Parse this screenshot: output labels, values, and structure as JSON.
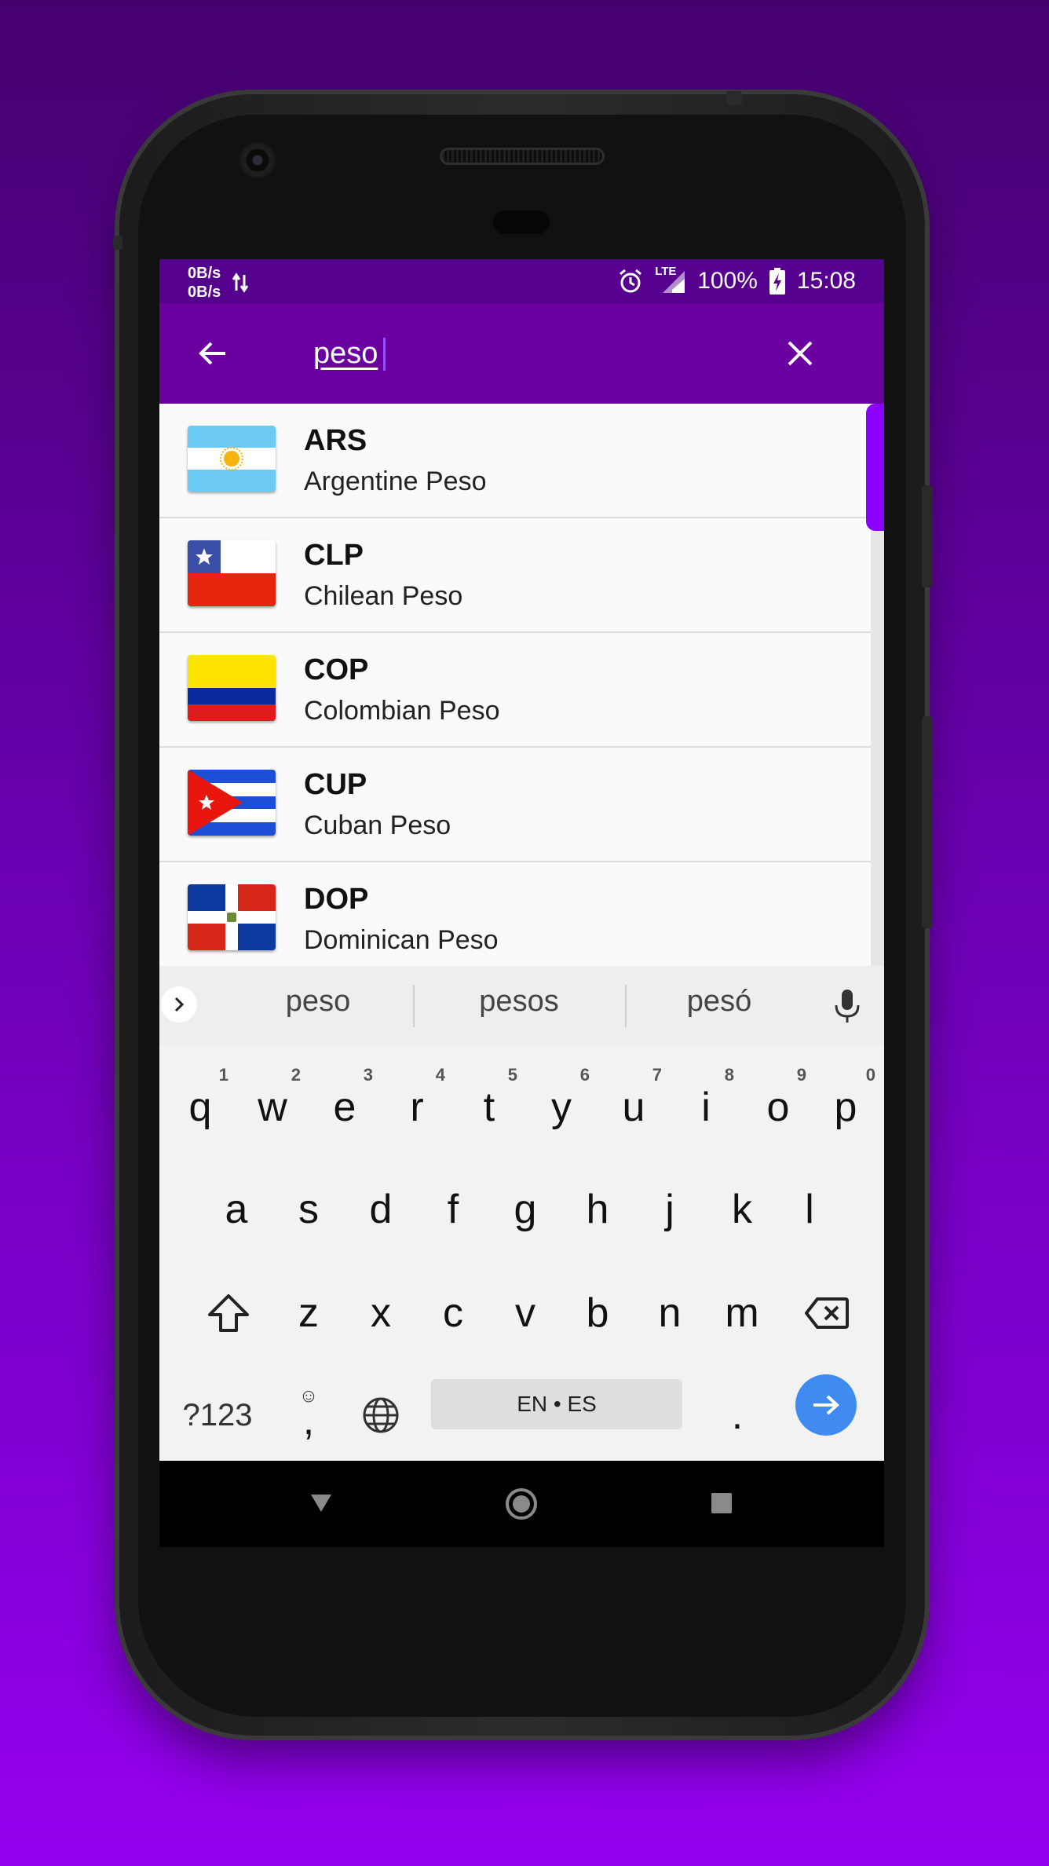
{
  "status_bar": {
    "net_up": "0B/s",
    "net_down": "0B/s",
    "network_type": "LTE",
    "battery": "100%",
    "time": "15:08",
    "icons": [
      "data-arrows-icon",
      "alarm-icon",
      "signal-icon",
      "battery-charging-icon"
    ]
  },
  "search": {
    "value": "peso",
    "back_icon": "arrow-left-icon",
    "clear_icon": "close-icon"
  },
  "colors": {
    "status_bar": "#55008e",
    "app_bar": "#6a009f",
    "scroll_thumb": "#8b00ff",
    "enter_key": "#3f8bf0"
  },
  "results": [
    {
      "code": "ARS",
      "name": "Argentine Peso",
      "flag": "argentina-flag"
    },
    {
      "code": "CLP",
      "name": "Chilean Peso",
      "flag": "chile-flag"
    },
    {
      "code": "COP",
      "name": "Colombian Peso",
      "flag": "colombia-flag"
    },
    {
      "code": "CUP",
      "name": "Cuban Peso",
      "flag": "cuba-flag"
    },
    {
      "code": "DOP",
      "name": "Dominican Peso",
      "flag": "dominican-republic-flag"
    }
  ],
  "keyboard": {
    "suggestions": [
      "peso",
      "pesos",
      "pesó"
    ],
    "row1": [
      "q",
      "w",
      "e",
      "r",
      "t",
      "y",
      "u",
      "i",
      "o",
      "p"
    ],
    "row1_hints": [
      "1",
      "2",
      "3",
      "4",
      "5",
      "6",
      "7",
      "8",
      "9",
      "0"
    ],
    "row2": [
      "a",
      "s",
      "d",
      "f",
      "g",
      "h",
      "j",
      "k",
      "l"
    ],
    "row3": [
      "z",
      "x",
      "c",
      "v",
      "b",
      "n",
      "m"
    ],
    "symbols_label": "?123",
    "comma": ",",
    "space_label": "EN • ES",
    "period": "."
  }
}
